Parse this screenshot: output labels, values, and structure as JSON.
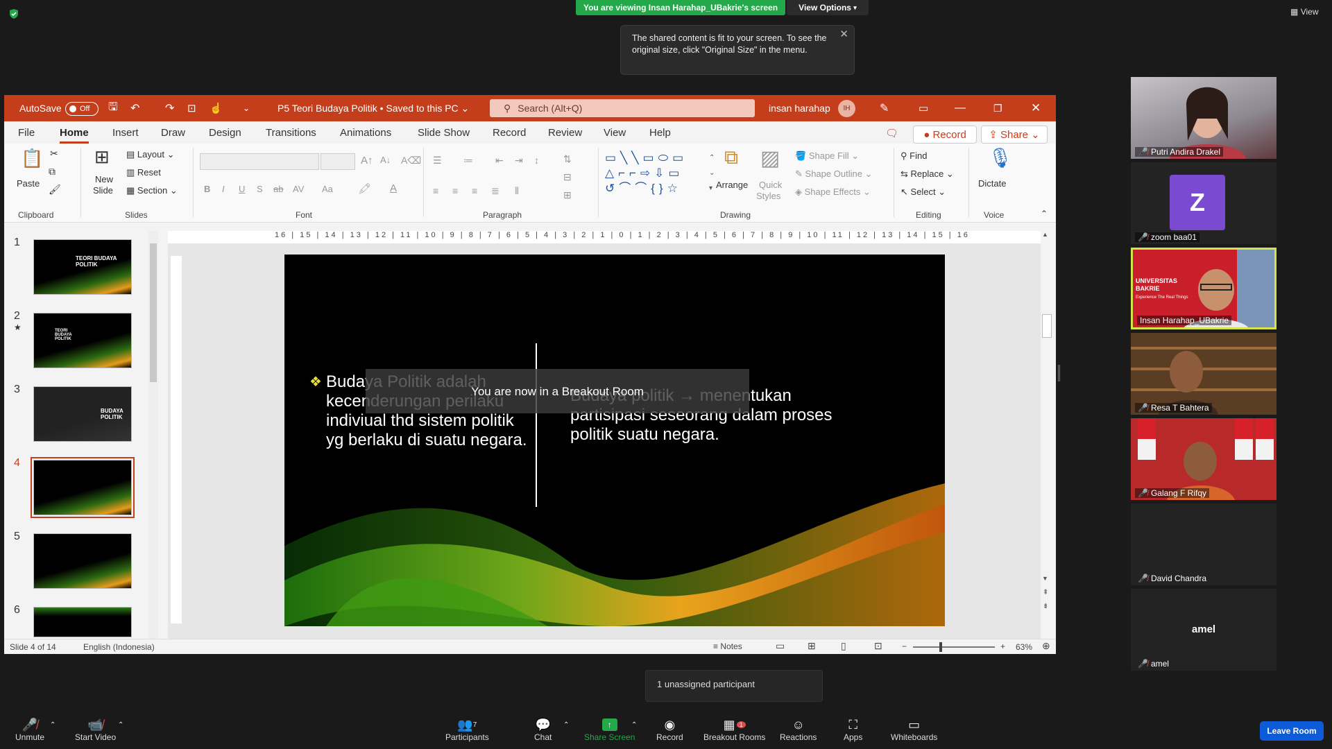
{
  "zoom": {
    "share_banner": "You are viewing Insan Harahap_UBakrie's screen",
    "view_options": "View Options",
    "view_label": "View",
    "tooltip": "The shared content is fit to your screen. To see the original size, click \"Original Size\" in the menu.",
    "overlay_message": "You are now in a Breakout Room",
    "unassigned": "1 unassigned participant",
    "leave_room": "Leave Room",
    "participants": [
      {
        "name": "Putri Andira Drakel"
      },
      {
        "name": "zoom baa01",
        "initial": "Z"
      },
      {
        "name": "Insan Harahap_UBakrie",
        "banner_line1": "UNIVERSITAS",
        "banner_line2": "BAKRIE",
        "banner_tagline": "Experience The Real Things"
      },
      {
        "name": "Resa T Bahtera"
      },
      {
        "name": "Galang F Rifqy"
      },
      {
        "name": "David Chandra"
      },
      {
        "name": "amel",
        "center_label": "amel"
      }
    ],
    "toolbar": {
      "unmute": "Unmute",
      "start_video": "Start Video",
      "participants": "Participants",
      "participants_count": "7",
      "chat": "Chat",
      "share_screen": "Share Screen",
      "record": "Record",
      "breakout_rooms": "Breakout Rooms",
      "breakout_badge": "1",
      "reactions": "Reactions",
      "apps": "Apps",
      "whiteboards": "Whiteboards"
    },
    "colors": {
      "green": "#23a84a",
      "blue": "#0e5bd9",
      "ppt_red": "#c43e1c"
    }
  },
  "ppt": {
    "autosave": "AutoSave",
    "autosave_state": "Off",
    "doc_title": "P5 Teori Budaya Politik • Saved to this PC",
    "search_placeholder": "Search (Alt+Q)",
    "user": "insan harahap",
    "user_initials": "IH",
    "menu": [
      "File",
      "Home",
      "Insert",
      "Draw",
      "Design",
      "Transitions",
      "Animations",
      "Slide Show",
      "Record",
      "Review",
      "View",
      "Help"
    ],
    "record_btn": "Record",
    "share_btn": "Share",
    "ribbon": {
      "paste": "Paste",
      "clipboard": "Clipboard",
      "new_slide_1": "New",
      "new_slide_2": "Slide",
      "layout": "Layout",
      "reset": "Reset",
      "section": "Section",
      "slides": "Slides",
      "font": "Font",
      "paragraph": "Paragraph",
      "arrange": "Arrange",
      "quick_styles_1": "Quick",
      "quick_styles_2": "Styles",
      "shape_fill": "Shape Fill",
      "shape_outline": "Shape Outline",
      "shape_effects": "Shape Effects",
      "drawing": "Drawing",
      "find": "Find",
      "replace": "Replace",
      "select": "Select",
      "editing": "Editing",
      "dictate": "Dictate",
      "voice": "Voice"
    },
    "ruler_h": "16 | 15 | 14 | 13 | 12 | 11 | 10 | 9 | 8 | 7 | 6 | 5 | 4 | 3 | 2 | 1 | 0 | 1 | 2 | 3 | 4 | 5 | 6 | 7 | 8 | 9 | 10 | 11 | 12 | 13 | 14 | 15 | 16",
    "thumbs": [
      {
        "num": "1",
        "title": "TEORI BUDAYA POLITIK"
      },
      {
        "num": "2",
        "title": "TEORI BUDAYA POLITIK"
      },
      {
        "num": "3",
        "title": "BUDAYA POLITIK"
      },
      {
        "num": "4",
        "title": ""
      },
      {
        "num": "5",
        "title": ""
      },
      {
        "num": "6",
        "title": ""
      }
    ],
    "slide": {
      "left_bullet": "Budaya Politik adalah kecenderungan perilaku indiviual thd sistem politik yg berlaku di suatu negara.",
      "right_bullet": "Budaya politik → menentukan partisipasi seseorang dalam proses politik suatu negara."
    },
    "status": {
      "slide_of": "Slide 4 of 14",
      "language": "English (Indonesia)",
      "notes": "Notes",
      "zoom": "63%"
    }
  }
}
